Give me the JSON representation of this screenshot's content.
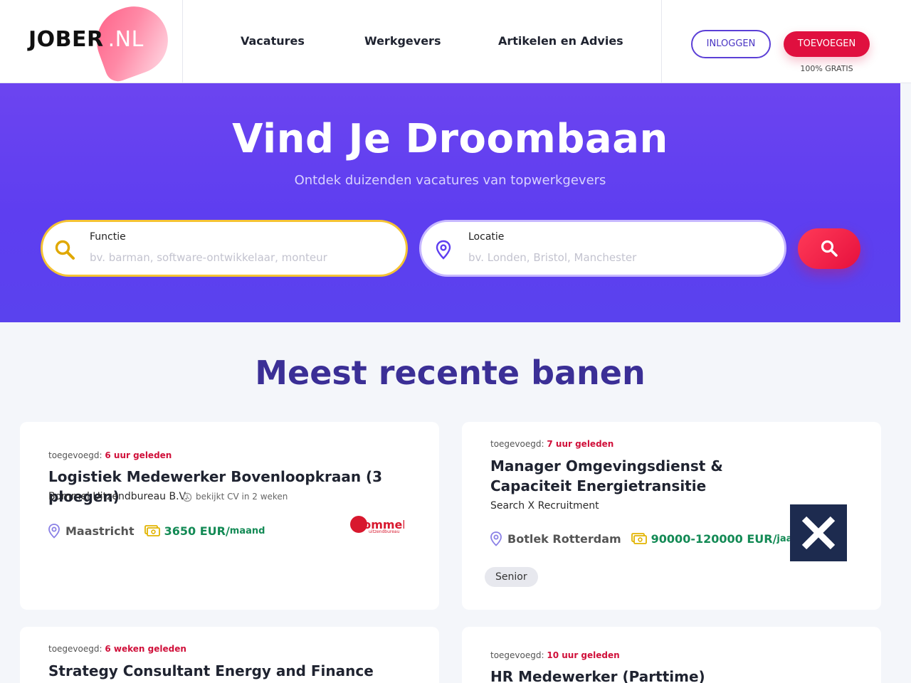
{
  "header": {
    "logo_text": "JOBER",
    "logo_suffix": ".NL",
    "nav": [
      "Vacatures",
      "Werkgevers",
      "Artikelen en Advies"
    ],
    "login_label": "INLOGGEN",
    "add_label": "TOEVOEGEN",
    "free_label": "100% GRATIS"
  },
  "hero": {
    "title": "Vind Je Droombaan",
    "subtitle": "Ontdek duizenden vacatures van topwerkgevers",
    "function_label": "Functie",
    "function_placeholder": "bv. barman, software-ontwikkelaar, monteur",
    "location_label": "Locatie",
    "location_placeholder": "bv. Londen, Bristol, Manchester"
  },
  "section_title": "Meest recente banen",
  "jobs": [
    {
      "added_prefix": "toegevoegd:",
      "added": "6 uur geleden",
      "title": "Logistiek Medewerker Bovenloopkraan (3 ploegen)",
      "company": "Bommel Uitzendbureau B.V.",
      "cv_note": "bekijkt CV in 2 weken",
      "location": "Maastricht",
      "salary": "3650 EUR/",
      "period": "maand",
      "logo_text": "Bommel",
      "logo_sub": "uitzendbureau"
    },
    {
      "added_prefix": "toegevoegd:",
      "added": "7 uur geleden",
      "title": "Manager Omgevingsdienst & Capaciteit Energietransitie",
      "company": "Search X Recruitment",
      "location": "Botlek Rotterdam",
      "salary": "90000-120000 EUR/",
      "period": "jaar",
      "tag": "Senior"
    },
    {
      "added_prefix": "toegevoegd:",
      "added": "6 weken geleden",
      "title": "Strategy Consultant Energy and Finance"
    },
    {
      "added_prefix": "toegevoegd:",
      "added": "10 uur geleden",
      "title": "HR Medewerker (Parttime)"
    }
  ],
  "colors": {
    "brand_purple": "#5e3ef0",
    "accent_red": "#e0103f",
    "salary_green": "#138a55",
    "title_indigo": "#3b2f96"
  }
}
